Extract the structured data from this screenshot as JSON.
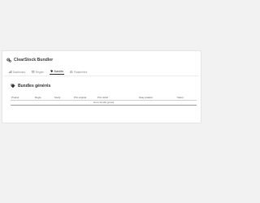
{
  "app": {
    "title": "ClearStock Bundler",
    "icon": "gears-icon"
  },
  "tabs": [
    {
      "label": "Dashboard",
      "icon": "dashboard-icon",
      "active": false
    },
    {
      "label": "Règles",
      "icon": "rules-icon",
      "active": false
    },
    {
      "label": "Bundles",
      "icon": "bundle-icon",
      "active": true
    },
    {
      "label": "Paramètres",
      "icon": "settings-icon",
      "active": false
    }
  ],
  "section": {
    "title": "Bundles générés",
    "icon": "tag-icon"
  },
  "table": {
    "columns": [
      "Produit",
      "Règle",
      "Stock",
      "Prix original",
      "Prix réduit",
      "Date création",
      "Statut"
    ],
    "empty_message": "Aucun bundle généré"
  },
  "colors": {
    "page_background": "#f2f2f2",
    "panel_background": "#ffffff",
    "active_tab": "#2b2b2b"
  }
}
